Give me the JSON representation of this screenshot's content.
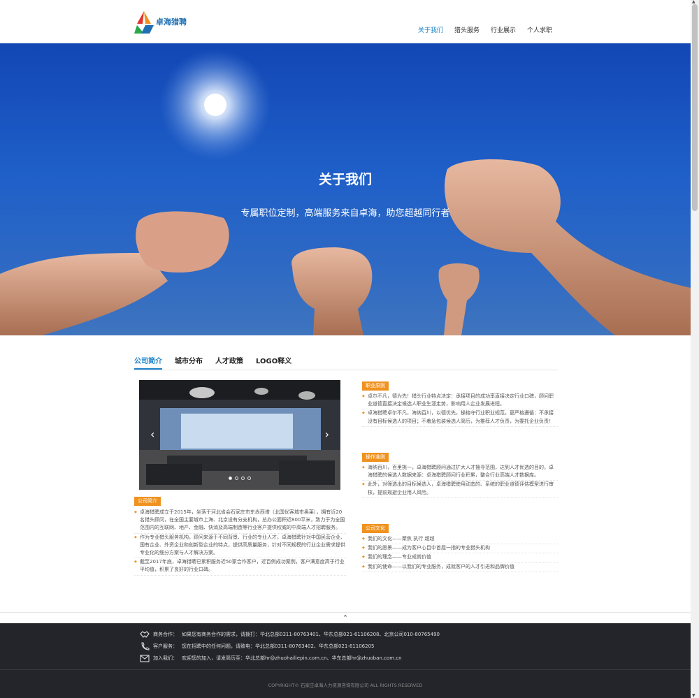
{
  "header": {
    "logo_text": "卓海猎聘",
    "nav": [
      "关于我们",
      "猎头服务",
      "行业展示",
      "个人求职"
    ],
    "active_index": 0
  },
  "hero": {
    "title": "关于我们",
    "subtitle": "专属职位定制，高端服务来自卓海，助您超越同行者"
  },
  "tabs": [
    "公司简介",
    "城市分布",
    "人才政策",
    "LOGO释义"
  ],
  "carousel": {
    "prev": "‹",
    "next": "›",
    "slide_count": 4,
    "active_slide": 0
  },
  "intro": {
    "badge": "公司简介",
    "items": [
      "卓海猎聘成立于2015年，坐落于河北省会石家庄市东尚西塔（北国优客城市奥莱），拥有近20名猎头顾问，在全国主要城市上海、北京设有分支机构，总办公面积近800平米，致力于为全国范围内的互联网、地产、金融、快消及高端制造等行业客户提供权威的中高端人才招聘服务。",
      "作为专业猎头服务机构，顾问来源于不同背景、行业的专业人才，卓海猎聘针对中国民营企业、国有企业、外资企业和创新型企业的特点，提供高质量服务，针对不同规模的行业企业需求提供专业化的细分方案与人才解决方案。",
      "截至2017年底，卓海猎聘已累积服务近50家合作客户，近百例成功案例，客户满意度高于行业平均值，积累了良好的行业口碑。"
    ]
  },
  "ethics": {
    "badge": "职业原则",
    "items": [
      "卓尔不凡，德为先！猎头行业特点决定：承接项目的成功率直接决定行业口碑，顾问职业道德直接决定候选人职业生涯走势，影响用人企业发展进程。",
      "卓海猎聘卓尔不凡，海纳百川，以德优先，操格守行业职业规范，更严格遵循：不承接没有目标候选人的项目；不着急包装候选人简历，为推荐人才负责，为委托企业负责！"
    ]
  },
  "operation": {
    "badge": "操作准则",
    "items": [
      "海纳百川，百里挑一，卓海猎聘顾问通过扩大人才搜寻范围，达到人才优选的目的，卓海猎聘的候选人数据来源：卓海猎聘顾问行业积累，整合行业高端人才数据库。",
      "此外，对筛选出的目标候选人，卓海猎聘使用动态的、系统的职业道德评估模型进行审核，提前规避企业用人风险。"
    ]
  },
  "culture": {
    "badge": "公司文化",
    "items": [
      "我们的文化——聚焦 执行 超越",
      "我们的愿景——成为客户心目中首屈一指的专业猎头机构",
      "我们的理念——专业成就价值",
      "我们的使命——以我们的专业服务，成就客户的人才引进和品牌价值"
    ]
  },
  "back_to_top": "⌃",
  "footer": {
    "rows": [
      {
        "icon": "handshake-icon",
        "label": "商务合作：",
        "text": "如果您有商务合作的需求，请拨打：华北总部0311-80763401、华东总部021-61106208、北京公司010-80765490"
      },
      {
        "icon": "phone-icon",
        "label": "客户服务：",
        "text": "您在招聘中的任何问题，请致电：华北总部0311-80763402、华东总部021-61106205"
      },
      {
        "icon": "mail-icon",
        "label": "加入我们：",
        "text": "欢迎您的加入，请发简历至：华北总部hr@zhuohailiepin.com.cn、华东总部hr@zhuoban.com.cn"
      }
    ],
    "copyright": "COPYRIGHT© 石家庄卓海人力资源咨询有限公司 ALL RIGHTS RESERVED"
  },
  "colors": {
    "accent": "#1a82c8",
    "badge": "#f0921f",
    "footer_bg": "#23252a",
    "hero_sky": "#1f5fc8"
  }
}
